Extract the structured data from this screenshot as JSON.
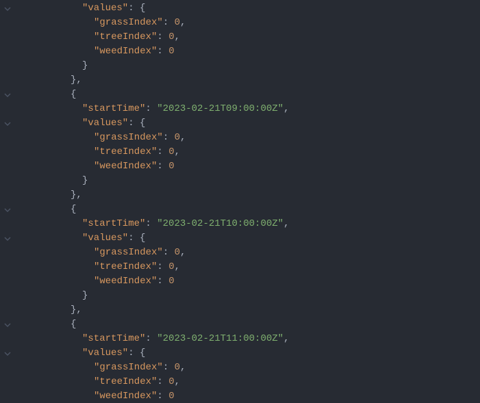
{
  "blocks": [
    {
      "partial_head": true,
      "startTime": null,
      "grassIndex": 0,
      "treeIndex": 0,
      "weedIndex": 0
    },
    {
      "partial_head": false,
      "startTime": "2023-02-21T09:00:00Z",
      "grassIndex": 0,
      "treeIndex": 0,
      "weedIndex": 0
    },
    {
      "partial_head": false,
      "startTime": "2023-02-21T10:00:00Z",
      "grassIndex": 0,
      "treeIndex": 0,
      "weedIndex": 0
    },
    {
      "partial_head": false,
      "startTime": "2023-02-21T11:00:00Z",
      "grassIndex": 0,
      "treeIndex": 0,
      "weedIndex": 0,
      "partial_tail": true
    }
  ],
  "keys": {
    "startTime": "startTime",
    "values": "values",
    "grassIndex": "grassIndex",
    "treeIndex": "treeIndex",
    "weedIndex": "weedIndex"
  },
  "chart_data": {
    "type": "table",
    "title": "",
    "columns": [
      "startTime",
      "grassIndex",
      "treeIndex",
      "weedIndex"
    ],
    "rows": [
      [
        "2023-02-21T09:00:00Z",
        0,
        0,
        0
      ],
      [
        "2023-02-21T10:00:00Z",
        0,
        0,
        0
      ],
      [
        "2023-02-21T11:00:00Z",
        0,
        0,
        0
      ]
    ]
  }
}
